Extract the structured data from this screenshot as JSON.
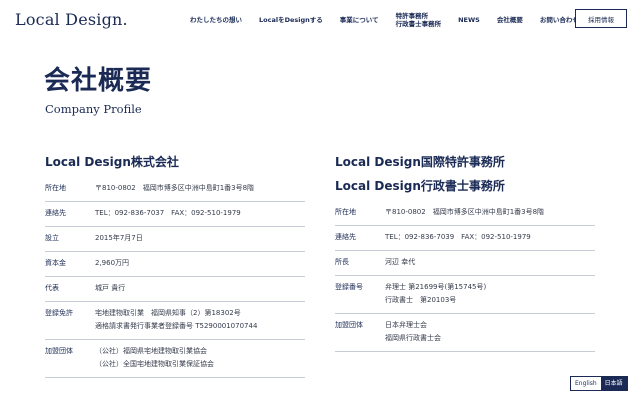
{
  "header": {
    "logo": "Local Design.",
    "nav": [
      {
        "lines": [
          "わたしたちの想い"
        ]
      },
      {
        "lines": [
          "LocalをDesignする"
        ]
      },
      {
        "lines": [
          "事業について"
        ]
      },
      {
        "lines": [
          "特許事務所",
          "行政書士事務所"
        ]
      },
      {
        "lines": [
          "NEWS"
        ]
      },
      {
        "lines": [
          "会社概要"
        ]
      },
      {
        "lines": [
          "お問い合わせ"
        ]
      }
    ],
    "recruit": "採用情報"
  },
  "page": {
    "title": "会社概要",
    "subtitle": "Company Profile"
  },
  "left": {
    "name_lines": [
      "Local Design株式会社"
    ],
    "rows": [
      {
        "label": "所在地",
        "value": [
          "〒810-0802　福岡市博多区中洲中島町1番3号8階"
        ]
      },
      {
        "label": "連絡先",
        "value": [
          "TEL：092-836-7037　FAX：092-510-1979"
        ]
      },
      {
        "label": "設立",
        "value": [
          "2015年7月7日"
        ]
      },
      {
        "label": "資本金",
        "value": [
          "2,960万円"
        ]
      },
      {
        "label": "代表",
        "value": [
          "城戸 貴行"
        ]
      },
      {
        "label": "登録免許",
        "value": [
          "宅地建物取引業　福岡県知事（2）第18302号",
          "適格請求書発行事業者登録番号 T5290001070744"
        ]
      },
      {
        "label": "加盟団体",
        "value": [
          "（公社）福岡県宅地建物取引業協会",
          "（公社）全国宅地建物取引業保証協会"
        ]
      }
    ]
  },
  "right": {
    "name_lines": [
      "Local Design国際特許事務所",
      "Local Design行政書士事務所"
    ],
    "rows": [
      {
        "label": "所在地",
        "value": [
          "〒810-0802　福岡市博多区中洲中島町1番3号8階"
        ]
      },
      {
        "label": "連絡先",
        "value": [
          "TEL：092-836-7039　FAX：092-510-1979"
        ]
      },
      {
        "label": "所長",
        "value": [
          "河辺 幸代"
        ]
      },
      {
        "label": "登録番号",
        "value": [
          "弁理士 第21699号(第15745号)",
          "行政書士　第20103号"
        ]
      },
      {
        "label": "加盟団体",
        "value": [
          "日本弁理士会",
          "福岡県行政書士会"
        ]
      }
    ]
  },
  "lang": {
    "en": "English",
    "ja": "日本語"
  }
}
